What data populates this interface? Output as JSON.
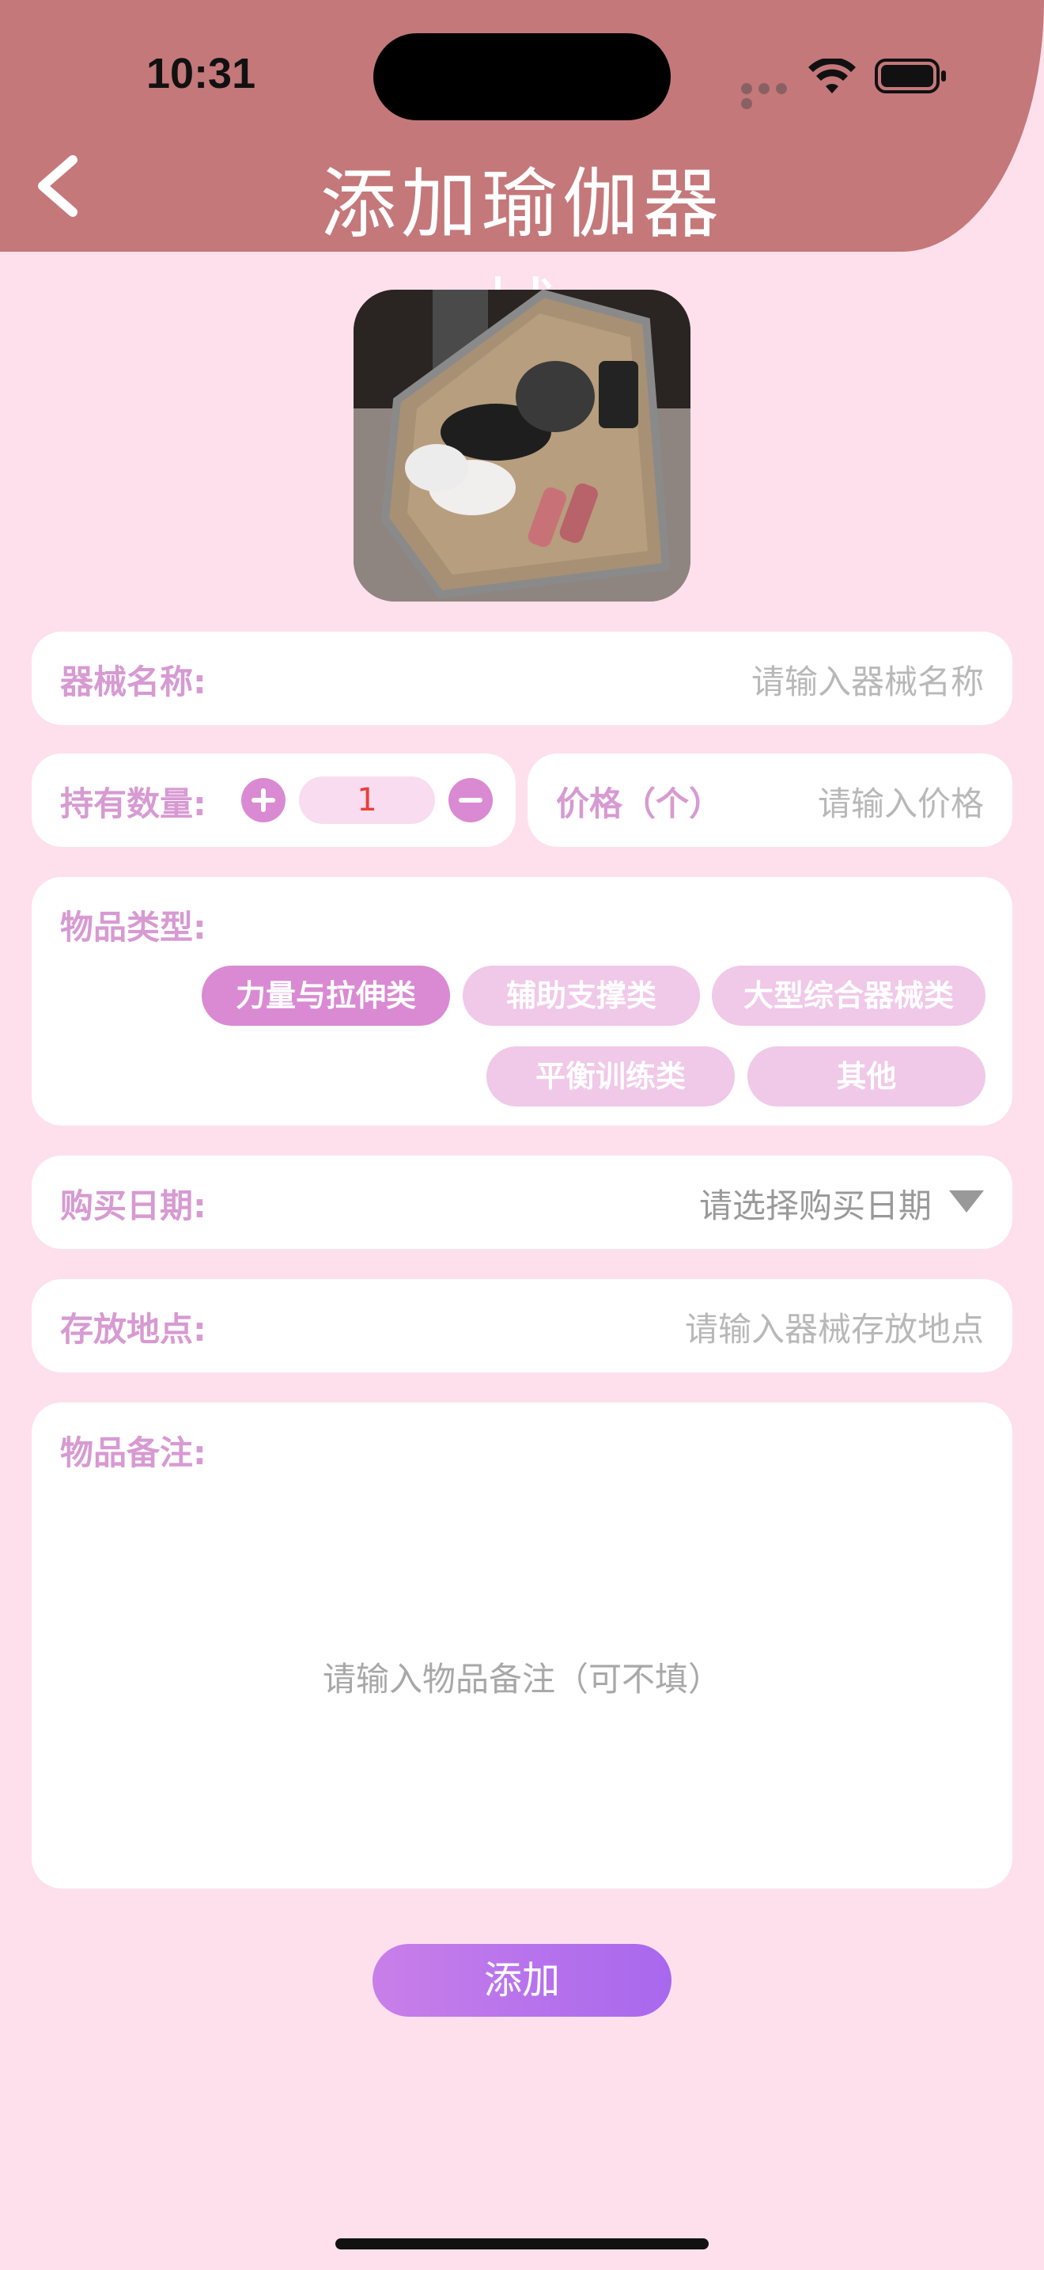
{
  "status_bar": {
    "time": "10:31"
  },
  "nav": {
    "title": "添加瑜伽器械",
    "back_icon": "chevron-left-icon"
  },
  "form": {
    "name": {
      "label": "器械名称:",
      "placeholder": "请输入器械名称"
    },
    "quantity": {
      "label": "持有数量:",
      "value": "1",
      "plus_icon": "plus-circle-icon",
      "minus_icon": "minus-circle-icon"
    },
    "price": {
      "label": "价格（个）",
      "placeholder": "请输入价格"
    },
    "category": {
      "label": "物品类型:",
      "options": [
        "力量与拉伸类",
        "辅助支撑类",
        "大型综合器械类",
        "平衡训练类",
        "其他"
      ],
      "selected": "力量与拉伸类"
    },
    "date": {
      "label": "购买日期:",
      "placeholder": "请选择购买日期",
      "dropdown_icon": "triangle-down-icon"
    },
    "location": {
      "label": "存放地点:",
      "placeholder": "请输入器械存放地点"
    },
    "notes": {
      "label": "物品备注:",
      "placeholder": "请输入物品备注（可不填）"
    }
  },
  "submit": {
    "label": "添加"
  },
  "colors": {
    "header": "#c4787a",
    "background": "#fde0ec",
    "label": "#d79ad2",
    "chip": "#f0c8e8",
    "chip_active": "#d98ad2",
    "quantity_value": "#e8403a"
  }
}
